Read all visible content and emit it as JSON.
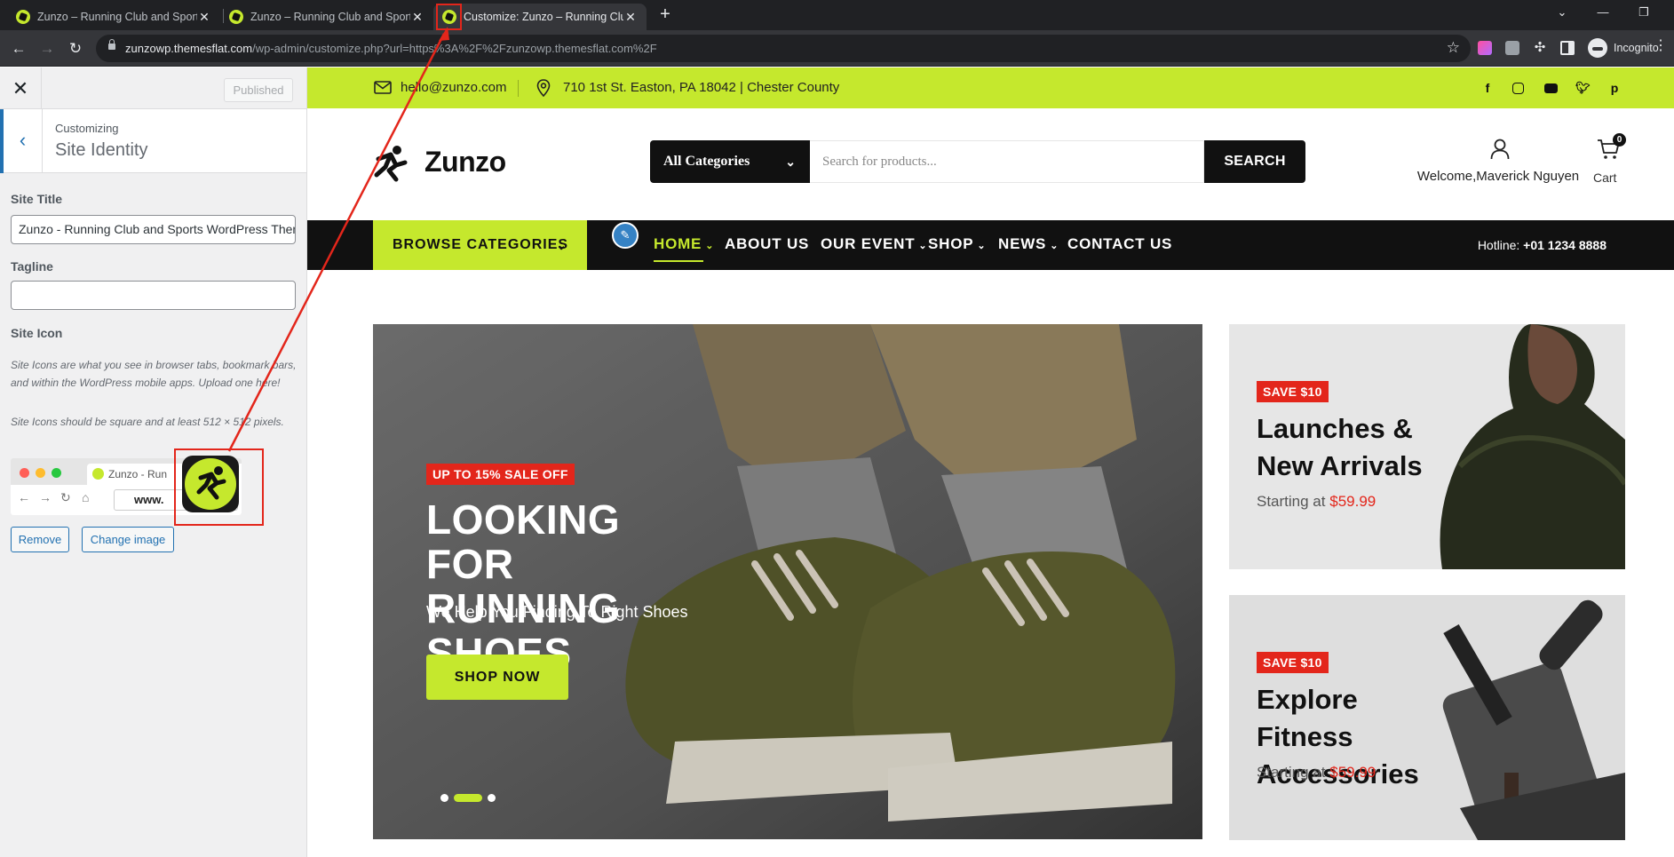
{
  "browser": {
    "tabs": [
      {
        "title": "Zunzo – Running Club and Sports"
      },
      {
        "title": "Zunzo – Running Club and Sports"
      },
      {
        "title": "Customize: Zunzo – Running Club"
      }
    ],
    "url_host": "zunzowp.themesflat.com",
    "url_path": "/wp-admin/customize.php?url=https%3A%2F%2Fzunzowp.themesflat.com%2F",
    "profile_label": "Incognito",
    "icons": [
      "back-icon",
      "forward-icon",
      "reload-icon",
      "lock-icon",
      "star-icon",
      "extensions-icon",
      "incognito-icon"
    ]
  },
  "customizer": {
    "publish_label": "Published",
    "breadcrumb": "Customizing",
    "section_title": "Site Identity",
    "site_title_label": "Site Title",
    "site_title_value": "Zunzo - Running Club and Sports WordPress Theme",
    "tagline_label": "Tagline",
    "tagline_value": "",
    "site_icon_label": "Site Icon",
    "site_icon_desc1": "Site Icons are what you see in browser tabs, bookmark bars, and within the WordPress mobile apps. Upload one here!",
    "site_icon_desc2": "Site Icons should be square and at least 512 × 512 pixels.",
    "preview_tab_text": "Zunzo - Run",
    "preview_url_text": "www.",
    "remove_label": "Remove",
    "change_label": "Change image"
  },
  "site": {
    "colors": {
      "accent": "#c5e82d",
      "dark": "#111111",
      "sale": "#e3261b"
    },
    "topbar": {
      "email": "hello@zunzo.com",
      "address": "710 1st St. Easton, PA 18042 | Chester County",
      "social_icons": [
        "facebook-icon",
        "instagram-icon",
        "youtube-icon",
        "twitter-icon",
        "pinterest-icon"
      ]
    },
    "header": {
      "logo_text": "Zunzo",
      "category_select": "All Categories",
      "search_placeholder": "Search for products...",
      "search_button": "SEARCH",
      "welcome_text": "Welcome,Maverick Nguyen",
      "cart_label": "Cart",
      "cart_count": "0"
    },
    "nav": {
      "browse_label": "BROWSE CATEGORIES",
      "items": [
        {
          "label": "HOME",
          "dropdown": true
        },
        {
          "label": "ABOUT US",
          "dropdown": false
        },
        {
          "label": "OUR EVENT",
          "dropdown": true
        },
        {
          "label": "SHOP",
          "dropdown": true
        },
        {
          "label": "NEWS",
          "dropdown": true
        },
        {
          "label": "CONTACT US",
          "dropdown": false
        }
      ],
      "hotline_label": "Hotline:",
      "hotline_number": "+01 1234 8888"
    },
    "hero": {
      "badge": "UP TO 15% SALE OFF",
      "title_line1": "LOOKING FOR",
      "title_line2": "RUNNING SHOES",
      "subtitle": "We Help You Finding To Right Shoes",
      "button": "SHOP NOW",
      "slides": 3,
      "active_slide": 2
    },
    "promos": [
      {
        "badge": "SAVE $10",
        "title_line1": "Launches &",
        "title_line2": "New Arrivals",
        "price_prefix": "Starting at",
        "price": "$59.99"
      },
      {
        "badge": "SAVE $10",
        "title_line1": "Explore Fitness",
        "title_line2": "Accessories",
        "price_prefix": "Starting at",
        "price": "$59.99"
      }
    ]
  }
}
